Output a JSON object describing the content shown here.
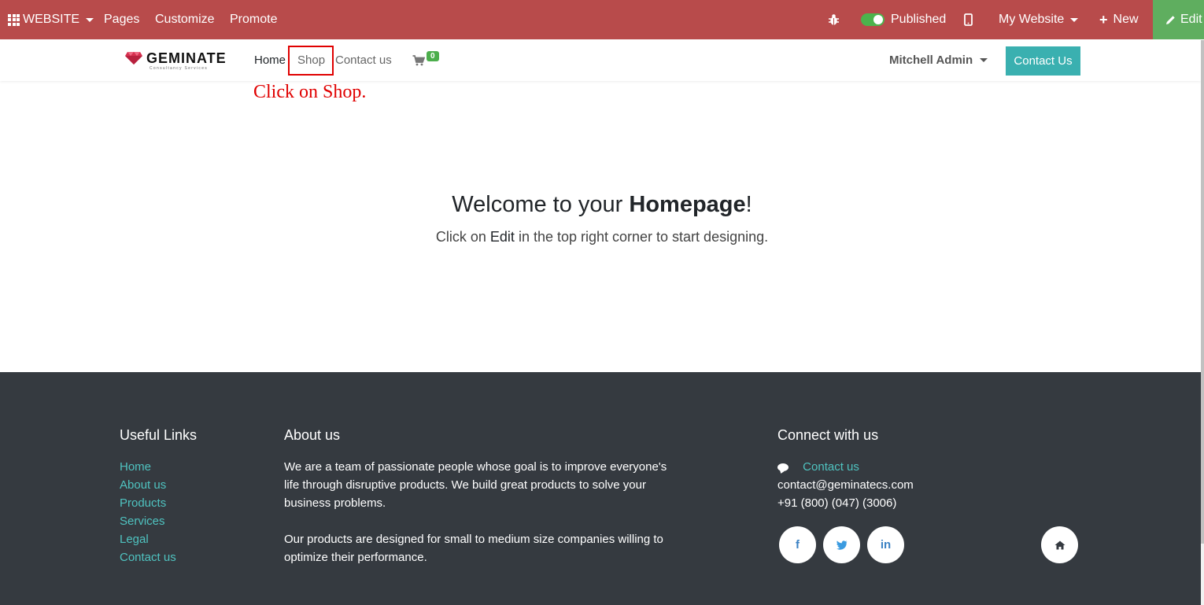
{
  "adminbar": {
    "website_label": "WEBSITE",
    "pages_label": "Pages",
    "customize_label": "Customize",
    "promote_label": "Promote",
    "published_label": "Published",
    "my_website_label": "My Website",
    "new_label": "New",
    "edit_label": "Edit"
  },
  "header": {
    "logo_text": "GEMINATE",
    "logo_subtitle": "Consultancy Services",
    "nav": [
      "Home",
      "Shop",
      "Contact us"
    ],
    "cart_count": "0",
    "user_name": "Mitchell Admin",
    "contact_button": "Contact Us"
  },
  "annotation": "Click on Shop.",
  "main": {
    "title_prefix": "Welcome to your ",
    "title_bold": "Homepage",
    "title_suffix": "!",
    "subtitle_prefix": "Click on ",
    "subtitle_bold": "Edit",
    "subtitle_suffix": " in the top right corner to start designing."
  },
  "footer": {
    "useful_links_heading": "Useful Links",
    "useful_links": [
      "Home",
      "About us",
      "Products",
      "Services",
      "Legal",
      "Contact us"
    ],
    "about_heading": "About us",
    "about_p1": "We are a team of passionate people whose goal is to improve everyone's life through disruptive products. We build great products to solve your business problems.",
    "about_p2": "Our products are designed for small to medium size companies willing to optimize their performance.",
    "connect_heading": "Connect with us",
    "contact_link": "Contact us",
    "email": "contact@geminatecs.com",
    "phone": "+91 (800) (047) (3006)",
    "social": {
      "facebook": "f",
      "twitter": "t",
      "linkedin": "in"
    }
  },
  "colors": {
    "adminbar": "#b84b4b",
    "edit_button": "#5fae5f",
    "accent_teal": "#3ab0b0",
    "footer_bg": "#353a40",
    "annotation": "#e00000"
  }
}
